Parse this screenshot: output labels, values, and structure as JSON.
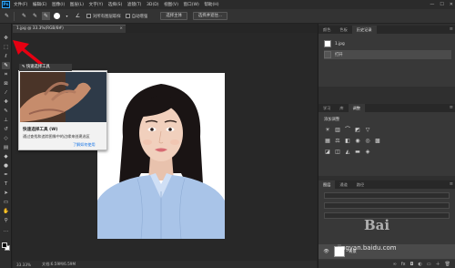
{
  "menubar": {
    "logo": "Ps",
    "items": [
      "文件(F)",
      "编辑(E)",
      "图像(I)",
      "图层(L)",
      "文字(Y)",
      "选择(S)",
      "滤镜(T)",
      "3D(D)",
      "视图(V)",
      "窗口(W)",
      "帮助(H)"
    ],
    "window_controls": [
      "—",
      "☐",
      "✕"
    ]
  },
  "options": {
    "sample_all_layers": "对所有图层取样",
    "auto_enhance": "自动增强",
    "select_subject": "选择主体",
    "select_and_mask": "选择并遮住..."
  },
  "document": {
    "tab_title": "1.jpg @ 33.3%(RGB/8#)",
    "zoom": "33.33%",
    "doc_size": "文档:6.59M/6.59M"
  },
  "tooltip": {
    "header": "快速选择工具",
    "title": "快速选择工具 (W)",
    "description": "通过查找和追踪图像中的边缘来创建选区",
    "link": "了解如何使用"
  },
  "panels": {
    "history_tabs": [
      "颜色",
      "色板",
      "历史记录"
    ],
    "history_items": [
      "1.jpg",
      "打开"
    ],
    "adjust_tabs": [
      "学习",
      "库",
      "调整"
    ],
    "adjust_label": "添加调整",
    "layers_tabs": [
      "图层",
      "通道",
      "路径"
    ],
    "layer_name": "背景"
  },
  "watermark": {
    "text": "jingyan.baidu.com",
    "logo": "Bai"
  },
  "colors": {
    "accent": "#1473e6",
    "arrow": "#e60012"
  }
}
